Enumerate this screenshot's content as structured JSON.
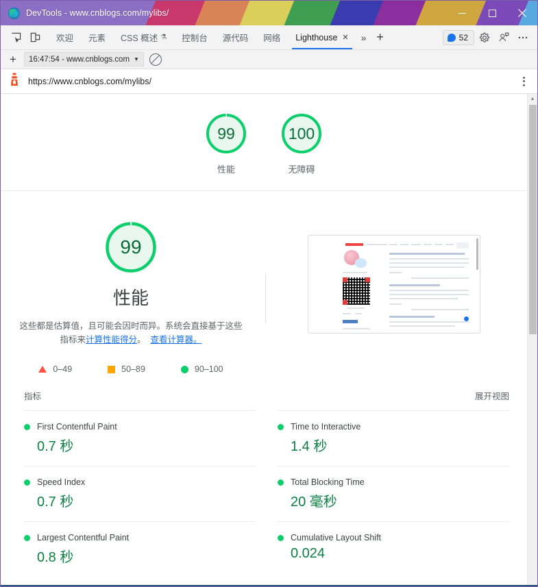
{
  "window": {
    "title": "DevTools - www.cnblogs.com/mylibs/",
    "logo_icon": "edge-logo-icon",
    "controls": {
      "minimize": "minimize-icon",
      "maximize": "maximize-icon",
      "close": "close-icon"
    },
    "titlebar_stripe_colors": [
      "#8b6fc4",
      "#c8386a",
      "#d98457",
      "#d9cf5a",
      "#3f9e52",
      "#3b3bb0",
      "#8b2f9e",
      "#cfa63f",
      "#7b49b8",
      "#5aa8e0"
    ]
  },
  "devtools": {
    "left_icons": [
      {
        "name": "inspect-element-icon"
      },
      {
        "name": "device-toolbar-icon"
      }
    ],
    "tabs": [
      {
        "label": "欢迎",
        "active": false
      },
      {
        "label": "元素",
        "active": false
      },
      {
        "label": "CSS 概述",
        "active": false,
        "suffix_icon": "experiment-flask-icon"
      },
      {
        "label": "控制台",
        "active": false
      },
      {
        "label": "源代码",
        "active": false
      },
      {
        "label": "网络",
        "active": false
      },
      {
        "label": "Lighthouse",
        "active": true,
        "closable": true
      }
    ],
    "more_tabs_icon": "chevron-double-right-icon",
    "new_tab_icon": "plus-icon",
    "messages": {
      "icon": "message-bubble-icon",
      "count": "52"
    },
    "settings_icon": "gear-icon",
    "feedback_icon": "feedback-icon",
    "more_options_icon": "ellipsis-icon"
  },
  "runbar": {
    "new_report_icon": "plus-icon",
    "report_chip": "16:47:54 - www.cnblogs.com",
    "chip_caret_icon": "chevron-down-icon",
    "clear_icon": "no-entry-icon"
  },
  "report_header": {
    "lighthouse_icon": "lighthouse-icon",
    "url": "https://www.cnblogs.com/mylibs/",
    "menu_icon": "kebab-menu-icon"
  },
  "top_gauges": [
    {
      "score": "99",
      "label": "性能",
      "color": "#0cce6b",
      "percent": 99
    },
    {
      "score": "100",
      "label": "无障碍",
      "color": "#0cce6b",
      "percent": 100
    }
  ],
  "performance": {
    "score": "99",
    "percent": 99,
    "color": "#0cce6b",
    "title": "性能",
    "description_part1": "这些都是估算值，且可能会因时而异。系统会直接基于这些指标来",
    "link1": "计算性能得分",
    "description_part2": "。",
    "link2": "查看计算器。",
    "legend": [
      {
        "icon": "triangle-icon",
        "range": "0–49",
        "color": "#ff4e42"
      },
      {
        "icon": "square-icon",
        "range": "50–89",
        "color": "#ffa400"
      },
      {
        "icon": "circle-icon",
        "range": "90–100",
        "color": "#0cce6b"
      }
    ],
    "screenshot_alt": "page-screenshot-thumbnail"
  },
  "metrics_section": {
    "heading": "指标",
    "expand_label": "展开视图",
    "items": [
      {
        "name": "First Contentful Paint",
        "value": "0.7 秒",
        "status_color": "#0cce6b"
      },
      {
        "name": "Time to Interactive",
        "value": "1.4 秒",
        "status_color": "#0cce6b"
      },
      {
        "name": "Speed Index",
        "value": "0.7 秒",
        "status_color": "#0cce6b"
      },
      {
        "name": "Total Blocking Time",
        "value": "20 毫秒",
        "status_color": "#0cce6b"
      },
      {
        "name": "Largest Contentful Paint",
        "value": "0.8 秒",
        "status_color": "#0cce6b"
      },
      {
        "name": "Cumulative Layout Shift",
        "value": "0.024",
        "status_color": "#0cce6b"
      }
    ]
  },
  "scrollbar": {
    "up_arrow_icon": "triangle-up-icon"
  }
}
